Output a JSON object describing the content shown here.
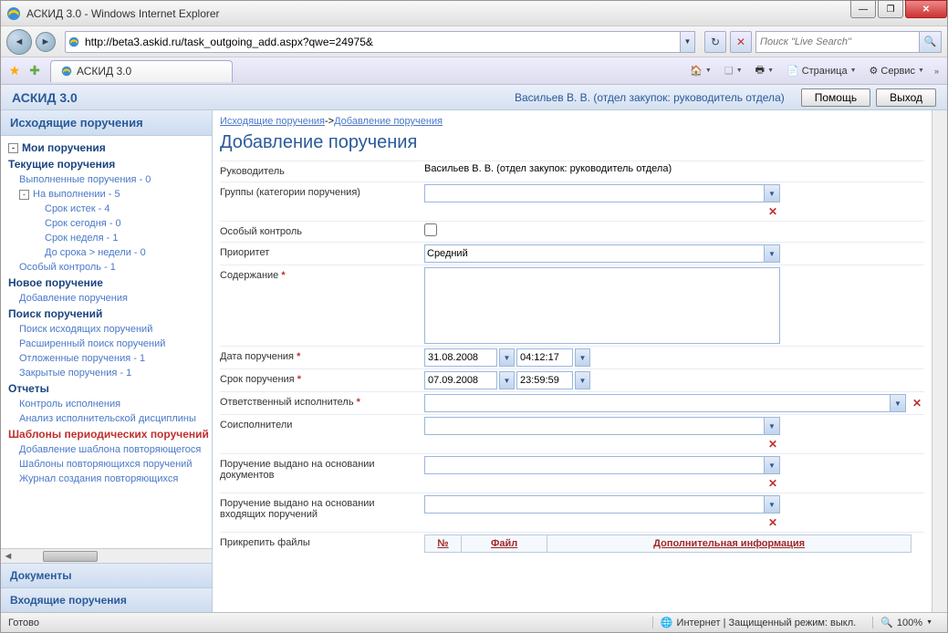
{
  "window": {
    "title": "АСКИД 3.0 - Windows Internet Explorer",
    "url": "http://beta3.askid.ru/task_outgoing_add.aspx?qwe=24975&",
    "search_placeholder": "Поиск \"Live Search\"",
    "tab_title": "АСКИД 3.0",
    "toolbar": {
      "home": "",
      "page": "Страница",
      "tools": "Сервис"
    }
  },
  "app": {
    "brand": "АСКИД 3.0",
    "user": "Васильев В. В. (отдел закупок: руководитель отдела)",
    "help": "Помощь",
    "exit": "Выход"
  },
  "sidebar": {
    "head": "Исходящие поручения",
    "items": [
      {
        "t": "Мои поручения",
        "cls": "bold",
        "ind": 0,
        "box": "-"
      },
      {
        "t": "Текущие поручения",
        "cls": "bold",
        "ind": 0
      },
      {
        "t": "Выполненные поручения - 0",
        "cls": "lnk",
        "ind": 1
      },
      {
        "t": "На выполнении - 5",
        "cls": "lnk",
        "ind": 1,
        "box": "-"
      },
      {
        "t": "Срок истек - 4",
        "cls": "lnk",
        "ind": 3
      },
      {
        "t": "Срок сегодня - 0",
        "cls": "lnk",
        "ind": 3
      },
      {
        "t": "Срок неделя - 1",
        "cls": "lnk",
        "ind": 3
      },
      {
        "t": "До срока > недели - 0",
        "cls": "lnk",
        "ind": 3
      },
      {
        "t": "Особый контроль - 1",
        "cls": "lnk",
        "ind": 1
      },
      {
        "t": "Новое поручение",
        "cls": "bold",
        "ind": 0
      },
      {
        "t": "Добавление поручения",
        "cls": "lnk",
        "ind": 1
      },
      {
        "t": "Поиск поручений",
        "cls": "bold",
        "ind": 0
      },
      {
        "t": "Поиск исходящих поручений",
        "cls": "lnk",
        "ind": 1
      },
      {
        "t": "Расширенный поиск поручений",
        "cls": "lnk",
        "ind": 1
      },
      {
        "t": "Отложенные поручения - 1",
        "cls": "lnk",
        "ind": 1
      },
      {
        "t": "Закрытые поручения - 1",
        "cls": "lnk",
        "ind": 1
      },
      {
        "t": "Отчеты",
        "cls": "bold",
        "ind": 0
      },
      {
        "t": "Контроль исполнения",
        "cls": "lnk",
        "ind": 1
      },
      {
        "t": "Анализ исполнительской дисциплины",
        "cls": "lnk",
        "ind": 1
      },
      {
        "t": "Шаблоны периодических поручений",
        "cls": "bold red",
        "ind": 0
      },
      {
        "t": "Добавление шаблона повторяющегося",
        "cls": "lnk",
        "ind": 1
      },
      {
        "t": "Шаблоны повторяющихся поручений",
        "cls": "lnk",
        "ind": 1
      },
      {
        "t": "Журнал создания повторяющихся",
        "cls": "lnk",
        "ind": 1
      }
    ],
    "foot1": "Документы",
    "foot2": "Входящие поручения"
  },
  "breadcrumb": {
    "a": "Исходящие поручения",
    "b": "Добавление поручения"
  },
  "page_title": "Добавление поручения",
  "form": {
    "supervisor_label": "Руководитель",
    "supervisor_value": "Васильев В. В. (отдел закупок: руководитель отдела)",
    "groups_label": "Группы (категории поручения)",
    "special_label": "Особый контроль",
    "priority_label": "Приоритет",
    "priority_value": "Средний",
    "content_label": "Содержание",
    "date_label": "Дата поручения",
    "date_value": "31.08.2008",
    "date_time_value": "04:12:17",
    "due_label": "Срок поручения",
    "due_value": "07.09.2008",
    "due_time_value": "23:59:59",
    "executor_label": "Ответственный исполнитель",
    "coexec_label": "Соисполнители",
    "based_docs_label": "Поручение выдано на основании документов",
    "based_incoming_label": "Поручение выдано на основании входящих поручений",
    "attach_label": "Прикрепить файлы",
    "file_th_no": "№",
    "file_th_file": "Файл",
    "file_th_info": "Дополнительная информация"
  },
  "status": {
    "ready": "Готово",
    "zone": "Интернет | Защищенный режим: выкл.",
    "zoom": "100%"
  }
}
